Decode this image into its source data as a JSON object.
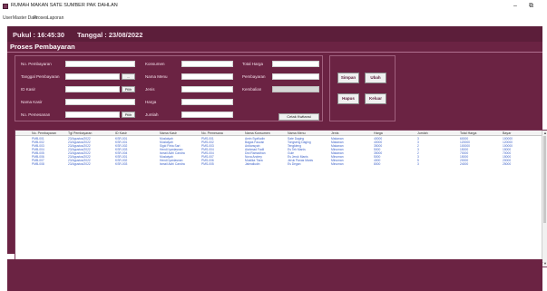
{
  "window": {
    "title": "RUMAH MAKAN SATE SUMBER PAK DAHLAN",
    "min_glyph": "–",
    "max_glyph": "⧉"
  },
  "menu": [
    "User",
    "Master Data",
    "Proses",
    "Laporan"
  ],
  "header": {
    "time_label": "Pukul : 16:45:30",
    "date_label": "Tanggal : 23/08/2022"
  },
  "section_title": "Proses Pembayaran",
  "form": {
    "no_pembayaran": "No. Pembayaran",
    "tanggal_pembayaran": "Tanggal Pembayaran",
    "id_kasir": "ID Kasir",
    "nama_kasir": "Nama Kasir",
    "no_pemesanan": "No. Pemesanan",
    "konsumen": "Konsumen",
    "nama_menu": "Nama Menu",
    "jenis": "Jenis",
    "harga": "Harga",
    "jumlah": "Jumlah",
    "total_harga": "Total Harga",
    "pembayaran": "Pembayaran",
    "kembalian": "Kembalian",
    "pilih": "Pilih",
    "date_btn": "...",
    "cetak_kwitansi": "Cetak Kwitansi"
  },
  "actions": {
    "simpan": "Simpan",
    "ubah": "Ubah",
    "hapus": "Hapus",
    "keluar": "Keluar"
  },
  "table": {
    "columns": [
      "No. Pembayaran",
      "Tgl Pembayaran",
      "ID Kasir",
      "Nama Kasir",
      "No. Pemesana",
      "Nama Konsumen",
      "Nama Menu",
      "Jenis",
      "Harga",
      "Jumlah",
      "Total Harga",
      "Bayar"
    ],
    "rows": [
      [
        "PMB-001",
        "23/Agustus/2022",
        "KSR-001",
        "Muslaiyah",
        "PMS-001",
        "Amin Syafiudin",
        "Sate Daging",
        "Makanan",
        "40000",
        "3",
        "60000",
        "100000"
      ],
      [
        "PMB-002",
        "23/Agustus/2022",
        "KSR-001",
        "Muslaiyah",
        "PMS-002",
        "Bagas Fauzan",
        "Tongseng Daging",
        "Makanan",
        "40000",
        "3",
        "120000",
        "120000"
      ],
      [
        "PMB-003",
        "23/Agustus/2022",
        "KSR-002",
        "Sigid Fitria Sari",
        "PMS-003",
        "Ardiansyah",
        "Tengkleng",
        "Makanan",
        "35000",
        "2",
        "100000",
        "100000"
      ],
      [
        "PMB-004",
        "23/Agustus/2022",
        "KSR-003",
        "Hendi Iyanlasnan",
        "PMS-004",
        "Aiahmad Fadil",
        "Es Teh Manis",
        "Minuman",
        "5000",
        "3",
        "15000",
        "15000"
      ],
      [
        "PMB-005",
        "23/Agustus/2022",
        "KSR-004",
        "Ismail Adhi Candra",
        "PMS-004",
        "Dwi Ramadhan",
        "Gule",
        "Makanan",
        "35000",
        "2",
        "70000",
        "70000"
      ],
      [
        "PMB-006",
        "23/Agustus/2022",
        "KSR-001",
        "Muslaiyah",
        "PMS-007",
        "Nova Andrey",
        "Es Jeruk Manis",
        "Minuman",
        "5000",
        "3",
        "15000",
        "15000"
      ],
      [
        "PMB-007",
        "23/Agustus/2022",
        "KSR-002",
        "Hendi Iyanlasnan",
        "PMS-006",
        "Mustika Tiara",
        "Jeruk Panas Manis",
        "Minuman",
        "4000",
        "5",
        "20000",
        "20000"
      ],
      [
        "PMB-008",
        "23/Agustus/2022",
        "KSR-003",
        "Ismail Adhi Candra",
        "PMS-005",
        "Jalmailudin",
        "Es Degan",
        "Minuman",
        "8000",
        "3",
        "24000",
        "25000"
      ]
    ],
    "scroll_up": "▲",
    "scroll_down": "▼"
  },
  "colors": {
    "panel": "#6b2343",
    "header": "#5c1e3a",
    "row_text": "#3f63c8"
  }
}
